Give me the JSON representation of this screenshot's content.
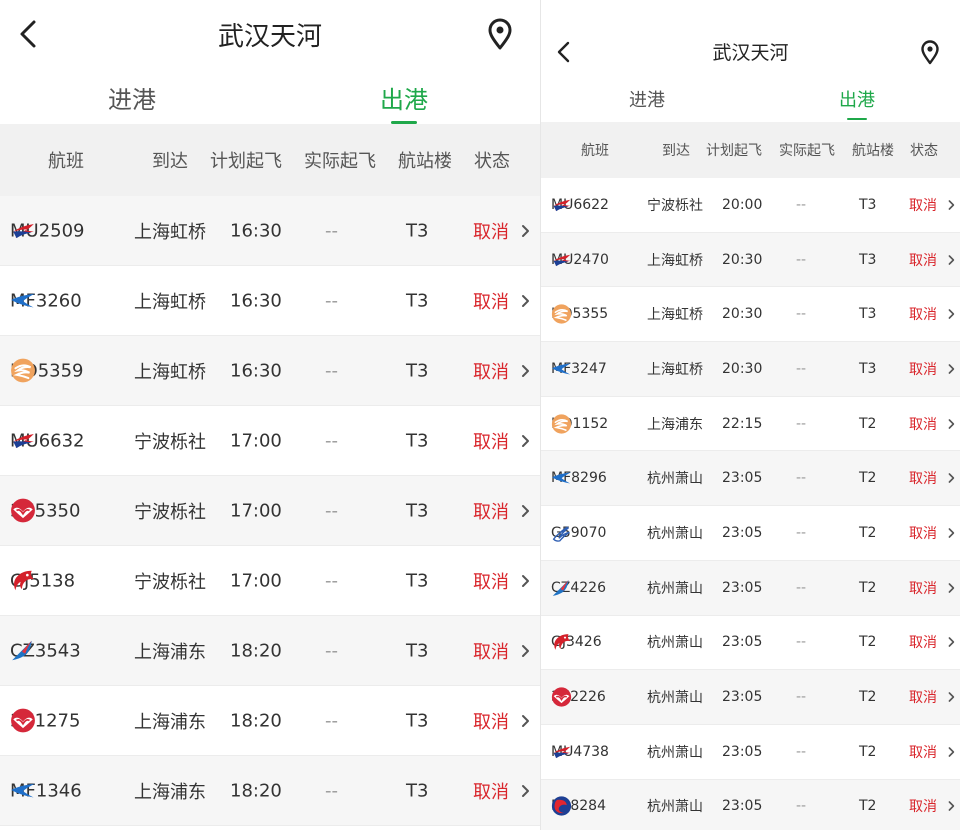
{
  "left": {
    "title": "武汉天河",
    "tabs": [
      {
        "label": "进港",
        "active": false
      },
      {
        "label": "出港",
        "active": true
      }
    ],
    "columns": [
      "航班",
      "到达",
      "计划起飞",
      "实际起飞",
      "航站楼",
      "状态"
    ],
    "flights": [
      {
        "airline": "MU",
        "flight": "MU2509",
        "dest": "上海虹桥",
        "planned": "16:30",
        "actual": "--",
        "terminal": "T3",
        "status": "取消"
      },
      {
        "airline": "MF",
        "flight": "MF3260",
        "dest": "上海虹桥",
        "planned": "16:30",
        "actual": "--",
        "terminal": "T3",
        "status": "取消"
      },
      {
        "airline": "HO",
        "flight": "HO5359",
        "dest": "上海虹桥",
        "planned": "16:30",
        "actual": "--",
        "terminal": "T3",
        "status": "取消"
      },
      {
        "airline": "MU",
        "flight": "MU6632",
        "dest": "宁波栎社",
        "planned": "17:00",
        "actual": "--",
        "terminal": "T3",
        "status": "取消"
      },
      {
        "airline": "3U",
        "flight": "3U5350",
        "dest": "宁波栎社",
        "planned": "17:00",
        "actual": "--",
        "terminal": "T3",
        "status": "取消"
      },
      {
        "airline": "GJ",
        "flight": "GJ5138",
        "dest": "宁波栎社",
        "planned": "17:00",
        "actual": "--",
        "terminal": "T3",
        "status": "取消"
      },
      {
        "airline": "CZ",
        "flight": "CZ3543",
        "dest": "上海浦东",
        "planned": "18:20",
        "actual": "--",
        "terminal": "T3",
        "status": "取消"
      },
      {
        "airline": "3U",
        "flight": "3U1275",
        "dest": "上海浦东",
        "planned": "18:20",
        "actual": "--",
        "terminal": "T3",
        "status": "取消"
      },
      {
        "airline": "MF",
        "flight": "MF1346",
        "dest": "上海浦东",
        "planned": "18:20",
        "actual": "--",
        "terminal": "T3",
        "status": "取消"
      }
    ]
  },
  "right": {
    "title": "武汉天河",
    "tabs": [
      {
        "label": "进港",
        "active": false
      },
      {
        "label": "出港",
        "active": true
      }
    ],
    "columns": [
      "航班",
      "到达",
      "计划起飞",
      "实际起飞",
      "航站楼",
      "状态"
    ],
    "flights": [
      {
        "airline": "MU",
        "flight": "MU6622",
        "dest": "宁波栎社",
        "planned": "20:00",
        "actual": "--",
        "terminal": "T3",
        "status": "取消"
      },
      {
        "airline": "MU",
        "flight": "MU2470",
        "dest": "上海虹桥",
        "planned": "20:30",
        "actual": "--",
        "terminal": "T3",
        "status": "取消"
      },
      {
        "airline": "HO",
        "flight": "HO5355",
        "dest": "上海虹桥",
        "planned": "20:30",
        "actual": "--",
        "terminal": "T3",
        "status": "取消"
      },
      {
        "airline": "MF",
        "flight": "MF3247",
        "dest": "上海虹桥",
        "planned": "20:30",
        "actual": "--",
        "terminal": "T3",
        "status": "取消"
      },
      {
        "airline": "HO",
        "flight": "HO1152",
        "dest": "上海浦东",
        "planned": "22:15",
        "actual": "--",
        "terminal": "T2",
        "status": "取消"
      },
      {
        "airline": "MF",
        "flight": "MF8296",
        "dest": "杭州萧山",
        "planned": "23:05",
        "actual": "--",
        "terminal": "T2",
        "status": "取消"
      },
      {
        "airline": "G5",
        "flight": "G59070",
        "dest": "杭州萧山",
        "planned": "23:05",
        "actual": "--",
        "terminal": "T2",
        "status": "取消"
      },
      {
        "airline": "CZ",
        "flight": "CZ4226",
        "dest": "杭州萧山",
        "planned": "23:05",
        "actual": "--",
        "terminal": "T2",
        "status": "取消"
      },
      {
        "airline": "GJ",
        "flight": "GJ3426",
        "dest": "杭州萧山",
        "planned": "23:05",
        "actual": "--",
        "terminal": "T2",
        "status": "取消"
      },
      {
        "airline": "3U",
        "flight": "3U2226",
        "dest": "杭州萧山",
        "planned": "23:05",
        "actual": "--",
        "terminal": "T2",
        "status": "取消"
      },
      {
        "airline": "MU",
        "flight": "MU4738",
        "dest": "杭州萧山",
        "planned": "23:05",
        "actual": "--",
        "terminal": "T2",
        "status": "取消"
      },
      {
        "airline": "NS",
        "flight": "NS8284",
        "dest": "杭州萧山",
        "planned": "23:05",
        "actual": "--",
        "terminal": "T2",
        "status": "取消"
      }
    ]
  },
  "colors": {
    "accent": "#1fa84a",
    "cancel": "#d9262c"
  },
  "icons": {
    "back": "chevron-left-icon",
    "location": "location-pin-icon",
    "row": "chevron-right-icon"
  }
}
